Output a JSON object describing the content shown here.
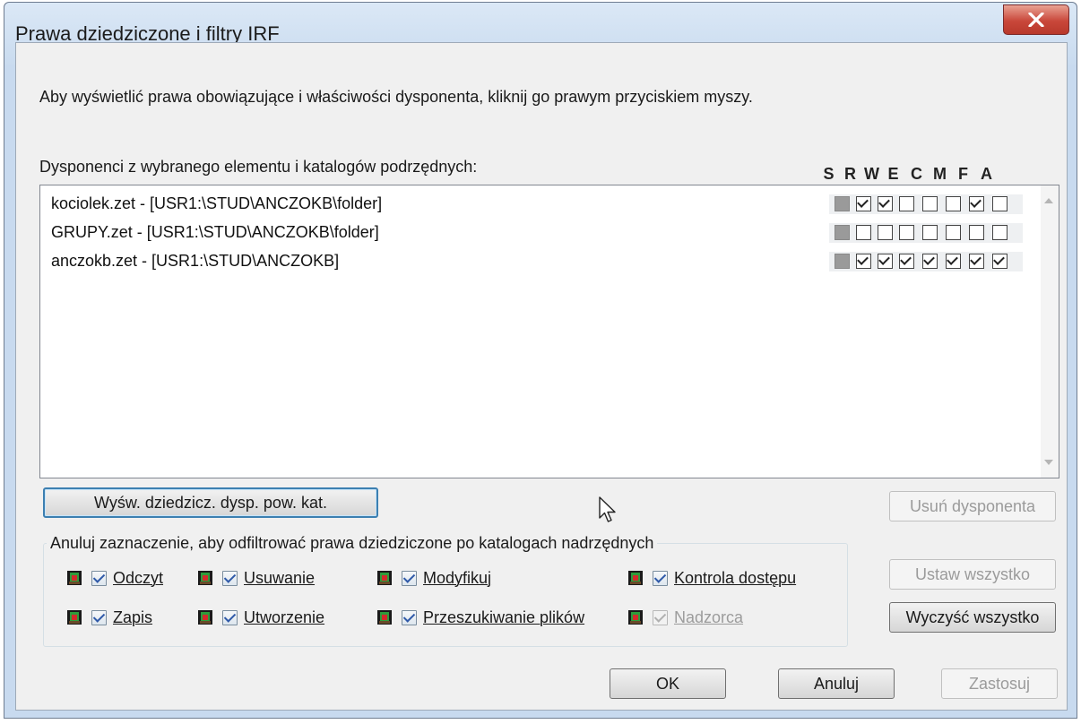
{
  "window": {
    "title": "Prawa dziedziczone i filtry IRF"
  },
  "description": "Aby wyświetlić prawa obowiązujące i właściwości dysponenta, kliknij go prawym przyciskiem myszy.",
  "list": {
    "label": "Dysponenci z wybranego elementu i katalogów podrzędnych:",
    "rights_headers": [
      "S",
      "R",
      "W",
      "E",
      "C",
      "M",
      "F",
      "A"
    ],
    "rows": [
      {
        "name": "kociolek.zet - [USR1:\\STUD\\ANCZOKB\\folder]",
        "rights": [
          false,
          true,
          true,
          false,
          false,
          false,
          true,
          false
        ]
      },
      {
        "name": "GRUPY.zet - [USR1:\\STUD\\ANCZOKB\\folder]",
        "rights": [
          false,
          false,
          false,
          false,
          false,
          false,
          false,
          false
        ]
      },
      {
        "name": "anczokb.zet - [USR1:\\STUD\\ANCZOKB]",
        "rights": [
          false,
          true,
          true,
          true,
          true,
          true,
          true,
          true
        ]
      }
    ]
  },
  "buttons": {
    "show_inherited": "Wyśw. dziedzicz. dysp. pow. kat.",
    "remove_trustee": "Usuń dysponenta",
    "set_all": "Ustaw wszystko",
    "clear_all": "Wyczyść wszystko",
    "ok": "OK",
    "cancel": "Anuluj",
    "apply": "Zastosuj"
  },
  "filters": {
    "group_title": "Anuluj zaznaczenie, aby odfiltrować prawa dziedziczone po katalogach nadrzędnych",
    "items": [
      {
        "label": "Odczyt",
        "checked": true,
        "enabled": true
      },
      {
        "label": "Usuwanie",
        "checked": true,
        "enabled": true
      },
      {
        "label": "Modyfikuj",
        "checked": true,
        "enabled": true
      },
      {
        "label": "Kontrola dostępu",
        "checked": true,
        "enabled": true
      },
      {
        "label": "Zapis",
        "checked": true,
        "enabled": true
      },
      {
        "label": "Utworzenie",
        "checked": true,
        "enabled": true
      },
      {
        "label": "Przeszukiwanie plików",
        "checked": true,
        "enabled": true
      },
      {
        "label": "Nadzorca",
        "checked": true,
        "enabled": false
      }
    ]
  },
  "colors": {
    "title_bar": "#c9dbef",
    "close_button": "#c9473a",
    "client_bg": "#f0f0f0",
    "focus_border": "#3c7fb1"
  }
}
